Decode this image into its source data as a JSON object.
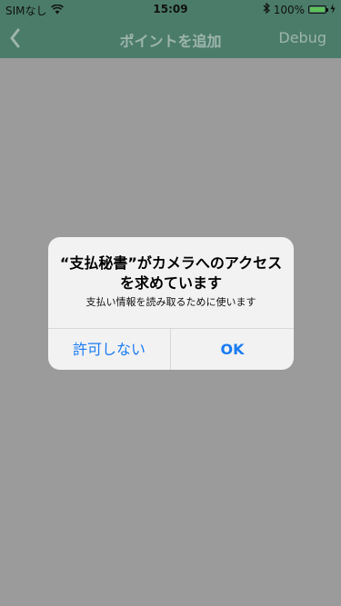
{
  "status_bar": {
    "carrier": "SIMなし",
    "time": "15:09",
    "battery_percent": "100%",
    "wifi_icon": "wifi-icon",
    "bluetooth_icon": "bluetooth-icon",
    "charging_icon": "charging-icon"
  },
  "nav_bar": {
    "back_icon": "chevron-left-icon",
    "title": "ポイントを追加",
    "debug_label": "Debug",
    "background_color": "#4b7c6a",
    "text_color": "#9eb5ad"
  },
  "alert": {
    "title_line1": "“支払秘書”がカメラへのアクセス",
    "title_line2": "を求めています",
    "message": "支払い情報を読み取るために使います",
    "deny_label": "許可しない",
    "ok_label": "OK",
    "button_color": "#1a7cf2"
  },
  "overlay_color": "#9b9b9b"
}
